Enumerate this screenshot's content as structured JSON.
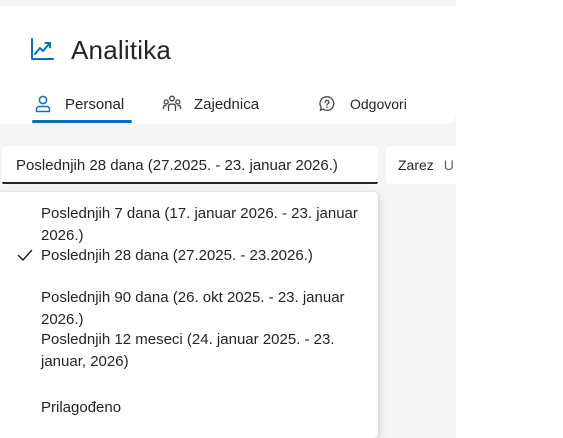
{
  "header": {
    "title": "Analitika",
    "tabs": [
      {
        "label": "Personal",
        "icon": "person-icon",
        "selected": true
      },
      {
        "label": "Zajednica",
        "icon": "people-community-icon",
        "selected": false
      },
      {
        "label": "Odgovori",
        "icon": "chat-help-icon",
        "selected": false
      }
    ]
  },
  "filters": {
    "date_range_value": "Poslednjih 28 dana (27.2025. - 23. januar 2026.)",
    "right_filter_label": "Zarez",
    "right_filter_value": "U"
  },
  "dropdown": {
    "options": [
      {
        "label": "Poslednjih 7 dana (17. januar 2026. - 23. januar 2026.)",
        "selected": false
      },
      {
        "label": "Poslednjih 28 dana (27.2025. - 23.2026.)",
        "selected": true
      },
      {
        "label": "Poslednjih 90 dana (26. okt 2025. - 23. januar 2026.)",
        "selected": false
      },
      {
        "label": "Poslednjih 12 meseci (24. januar 2025. - 23. januar, 2026)",
        "selected": false
      },
      {
        "label": "Prilagođeno",
        "selected": false
      }
    ]
  },
  "colors": {
    "accent": "#0f6cbd",
    "text": "#242424",
    "page_background": "#f5f5f5"
  }
}
